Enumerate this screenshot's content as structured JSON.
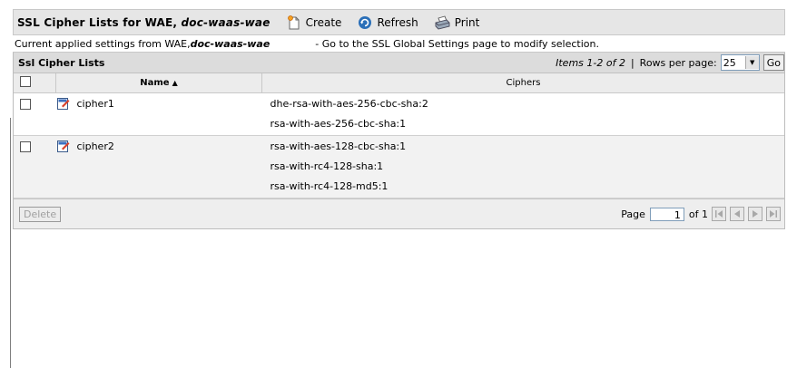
{
  "header": {
    "title_prefix": "SSL Cipher Lists for WAE, ",
    "title_device": "doc-waas-wae",
    "create_label": "Create",
    "refresh_label": "Refresh",
    "print_label": "Print"
  },
  "info": {
    "prefix": "Current applied settings from WAE, ",
    "device": "doc-waas-wae",
    "link_text": "- Go to the SSL Global Settings page to modify selection."
  },
  "panel": {
    "title": "Ssl Cipher Lists",
    "items_text": "Items 1-2 of 2",
    "separator": "|",
    "rows_per_page_label": "Rows per page:",
    "rows_per_page_value": "25",
    "go_label": "Go"
  },
  "table": {
    "columns": {
      "name": "Name",
      "ciphers": "Ciphers"
    },
    "rows": [
      {
        "name": "cipher1",
        "ciphers": [
          "dhe-rsa-with-aes-256-cbc-sha:2",
          "rsa-with-aes-256-cbc-sha:1",
          ""
        ]
      },
      {
        "name": "cipher2",
        "ciphers": [
          "rsa-with-aes-128-cbc-sha:1",
          "rsa-with-rc4-128-sha:1",
          "rsa-with-rc4-128-md5:1"
        ]
      }
    ]
  },
  "footer": {
    "delete_label": "Delete",
    "page_label": "Page",
    "page_value": "1",
    "of_label": "of 1"
  },
  "colors": {
    "toolbar_bg": "#e6e6e6",
    "panel_header_bg": "#dcdcdc",
    "refresh_icon": "#2a6fb8",
    "create_icon": "#e07a10"
  }
}
